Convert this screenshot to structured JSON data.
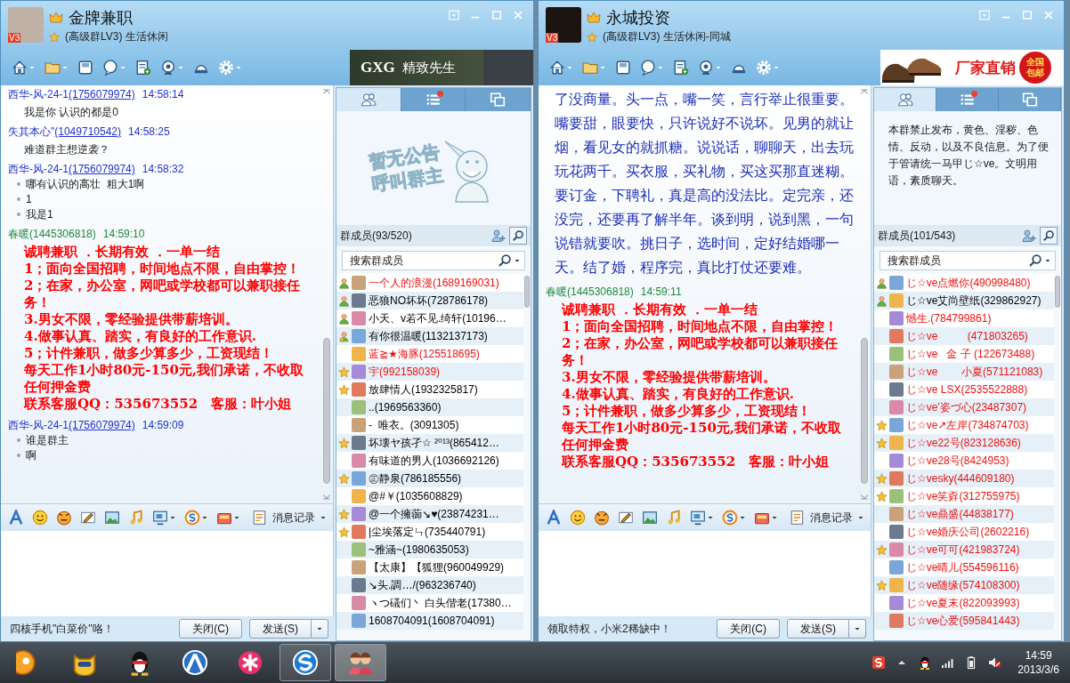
{
  "windows": [
    {
      "title": "金牌兼职",
      "subtitle": "(高级群LV3) 生活休闲",
      "avatar_badge": "V3",
      "ad": {
        "kind": "fashion",
        "texts": [
          "GXG",
          "精致先生"
        ]
      },
      "messages": [
        {
          "sender": "西华-风-24-1",
          "id": "(1756079974)",
          "id_link": true,
          "time": "14:58:14",
          "color": "#2233d0",
          "kind": "text",
          "lines": [
            "我是你  认识的都是0"
          ]
        },
        {
          "sender": "失其本心\"",
          "id": "(1049710542)",
          "id_link": true,
          "time": "14:58:25",
          "color": "#2233d0",
          "kind": "text",
          "lines": [
            "难道群主想逆袭？"
          ]
        },
        {
          "sender": "西华-风-24-1",
          "id": "(1756079974)",
          "id_link": true,
          "time": "14:58:32",
          "color": "#2233d0",
          "kind": "bullets",
          "lines": [
            "哪有认识的高壮  粗大1啊",
            "1",
            "我是1"
          ]
        },
        {
          "sender": "春暖",
          "id": "(1445306818)",
          "id_link": false,
          "time": "14:59:10",
          "color": "#1e8a3c",
          "kind": "ad",
          "lines": [
            "诚聘兼职 ．长期有效 ．一单一结",
            "1；面向全国招聘，时间地点不限，自由掌控！",
            "2；在家，办公室，网吧或学校都可以兼职接任务！",
            "3.男女不限，零经验提供带薪培训。",
            "4.做事认真、踏实，有良好的工作意识.",
            "5；计件兼职，做多少算多少，工资现结！",
            "每天工作1小时80元-150元,我们承诺，不收取任何押金费",
            "联系客服QQ：535673552　客服：叶小姐"
          ]
        },
        {
          "sender": "西华-风-24-1",
          "id": "(1756079974)",
          "id_link": true,
          "time": "14:59:09",
          "color": "#2233d0",
          "kind": "bullets",
          "lines": [
            "谁是群主",
            "啊"
          ]
        }
      ],
      "history_label": "消息记录",
      "status_text": "四核手机\"白菜价\"咯！",
      "close_button": "关闭(C)",
      "send_button": "发送(S)",
      "sidebar": {
        "tabs": [
          {
            "selected": true,
            "notification": false
          },
          {
            "selected": false,
            "notification": true
          },
          {
            "selected": false,
            "notification": false
          }
        ],
        "announcement": {
          "kind": "image",
          "texts": [
            "暂无公告",
            "呼叫群主"
          ]
        },
        "members_label": "群成员(93/520)",
        "search_placeholder": "搜索群成员",
        "members": [
          {
            "kind": "person",
            "name": "一个人的浪漫(1689169031)",
            "color": "#ee1111"
          },
          {
            "kind": "person",
            "name": "恶狼NO坏坏(728786178)",
            "color": "#000000"
          },
          {
            "kind": "person",
            "name": "小天、v若不见.绮轩(10196…",
            "color": "#000000"
          },
          {
            "kind": "person-star",
            "name": "有你很温暖(1132137173)",
            "color": "#000000"
          },
          {
            "kind": "plain",
            "name": "蓝≧★海豚(125518695)",
            "color": "#ee1111"
          },
          {
            "kind": "star",
            "name": "宇(992158039)",
            "color": "#ee1111"
          },
          {
            "kind": "star",
            "name": "放肆情人(1932325817)",
            "color": "#000000"
          },
          {
            "kind": "plain",
            "name": "..(1969563360)",
            "color": "#000000"
          },
          {
            "kind": "plain",
            "name": "-  唯衣。(3091305)",
            "color": "#000000"
          },
          {
            "kind": "star",
            "name": "坏壊ヤ孩孑☆ ²⁰¹³(865412…",
            "color": "#000000"
          },
          {
            "kind": "plain",
            "name": "有味道的男人(1036692126)",
            "color": "#000000"
          },
          {
            "kind": "star",
            "name": "㊣静泉(786185556)",
            "color": "#000000"
          },
          {
            "kind": "plain",
            "name": "@#￥(1035608829)",
            "color": "#000000"
          },
          {
            "kind": "star",
            "name": "@一个擁蓹↘♥(23874231…",
            "color": "#000000"
          },
          {
            "kind": "star",
            "name": "|尘埃落定ㄣ(735440791)",
            "color": "#000000"
          },
          {
            "kind": "plain",
            "name": "~雅涵~(1980635053)",
            "color": "#000000"
          },
          {
            "kind": "plain",
            "name": "【太康】【狐狸(960049929)",
            "color": "#000000"
          },
          {
            "kind": "plain",
            "name": "↘头.調…/(963236740)",
            "color": "#000000"
          },
          {
            "kind": "plain",
            "name": "ヽつ礒们丶 白头偕老(17380…",
            "color": "#000000"
          },
          {
            "kind": "plain",
            "name": "1608704091(1608704091)",
            "color": "#000000"
          }
        ]
      }
    },
    {
      "title": "永城投资",
      "subtitle": "(高级群LV3) 生活休闲-同城",
      "avatar_badge": "V3",
      "ad": {
        "kind": "shoes",
        "texts": [
          "厂家直销"
        ],
        "badge": "全国包邮"
      },
      "messages": [
        {
          "kind": "paragraph",
          "lines": [
            "了没商量。头一点，嘴一笑，言行举止很重要。嘴要甜，眼要快，只许说好不说坏。见男的就让烟，看见女的就抓糖。说说话，聊聊天，出去玩玩花两千。买衣服，买礼物，买这买那直迷糊。要订金，下聘礼，真是高的没法比。定完亲，还没完，还要再了解半年。谈到明，说到黑，一句说错就要吹。挑日子，选时间，定好结婚哪一天。结了婚，程序完，真比打仗还要难。"
          ]
        },
        {
          "sender": "春暖",
          "id": "(1445306818)",
          "id_link": false,
          "time": "14:59:11",
          "color": "#1e8a3c",
          "kind": "ad",
          "lines": [
            "诚聘兼职 ．长期有效 ．一单一结",
            "1；面向全国招聘，时间地点不限，自由掌控！",
            "2；在家，办公室，网吧或学校都可以兼职接任务！",
            "3.男女不限，零经验提供带薪培训。",
            "4.做事认真、踏实，有良好的工作意识.",
            "5；计件兼职，做多少算多少，工资现结！",
            "每天工作1小时80元-150元,我们承诺，不收取任何押金费",
            "联系客服QQ：535673552　客服：叶小姐"
          ]
        }
      ],
      "history_label": "消息记录",
      "status_text": "领取特权，小米2稀缺中！",
      "close_button": "关闭(C)",
      "send_button": "发送(S)",
      "sidebar": {
        "tabs": [
          {
            "selected": true,
            "notification": false
          },
          {
            "selected": false,
            "notification": true
          },
          {
            "selected": false,
            "notification": false
          }
        ],
        "announcement": {
          "kind": "text",
          "text": "本群禁止发布，黄色、淫秽、色情、反动，以及不良信息。为了便于管请统一马甲じ☆ve。文明用语，素质聊天。"
        },
        "members_label": "群成员(101/543)",
        "search_placeholder": "搜索群成员",
        "members": [
          {
            "kind": "person",
            "name": "じ☆ve点燃你(490998480)",
            "color": "#ee1111"
          },
          {
            "kind": "person",
            "name": "じ☆ve艾尚壁纸(329862927)",
            "color": "#000000"
          },
          {
            "kind": "plain",
            "name": "憾生.(784799861)",
            "color": "#ee1111"
          },
          {
            "kind": "plain",
            "name": "じ☆ve          (471803265)",
            "color": "#ee1111"
          },
          {
            "kind": "plain",
            "name": "じ☆ve   金 子 (122673488)",
            "color": "#ee1111"
          },
          {
            "kind": "plain",
            "name": "じ☆ve        小夏(571121083)",
            "color": "#ee1111"
          },
          {
            "kind": "plain",
            "name": "じ☆ve LSX(2535522888)",
            "color": "#ee1111"
          },
          {
            "kind": "plain",
            "name": "じ☆ve'姿づ心(23487307)",
            "color": "#ee1111"
          },
          {
            "kind": "star",
            "name": "じ☆ve↗左岸(734874703)",
            "color": "#ee1111"
          },
          {
            "kind": "star",
            "name": "じ☆ve22号(823128636)",
            "color": "#ee1111"
          },
          {
            "kind": "plain",
            "name": "じ☆ve28号(8424953)",
            "color": "#ee1111"
          },
          {
            "kind": "star",
            "name": "じ☆vesky(444609180)",
            "color": "#ee1111"
          },
          {
            "kind": "star",
            "name": "じ☆ve笑孬(312755975)",
            "color": "#ee1111"
          },
          {
            "kind": "plain",
            "name": "じ☆ve鼎盛(44838177)",
            "color": "#ee1111"
          },
          {
            "kind": "plain",
            "name": "じ☆ve婚庆公司(2602216)",
            "color": "#ee1111"
          },
          {
            "kind": "star",
            "name": "じ☆ve可可(421983724)",
            "color": "#ee1111"
          },
          {
            "kind": "plain",
            "name": "じ☆ve晴儿(554596116)",
            "color": "#ee1111"
          },
          {
            "kind": "star",
            "name": "じ☆ve随缘(574108300)",
            "color": "#ee1111"
          },
          {
            "kind": "plain",
            "name": "じ☆ve夏末(822093993)",
            "color": "#ee1111"
          },
          {
            "kind": "plain",
            "name": "じ☆ve心爱(595841443)",
            "color": "#ee1111"
          }
        ]
      }
    }
  ],
  "taskbar": {
    "apps": [
      {
        "open": false,
        "selected": false
      },
      {
        "open": false,
        "selected": false
      },
      {
        "open": false,
        "selected": false
      },
      {
        "open": false,
        "selected": false
      },
      {
        "open": false,
        "selected": false
      },
      {
        "open": true,
        "selected": false
      },
      {
        "open": true,
        "selected": true
      }
    ],
    "time": "14:59",
    "date": "2013/3/6"
  }
}
